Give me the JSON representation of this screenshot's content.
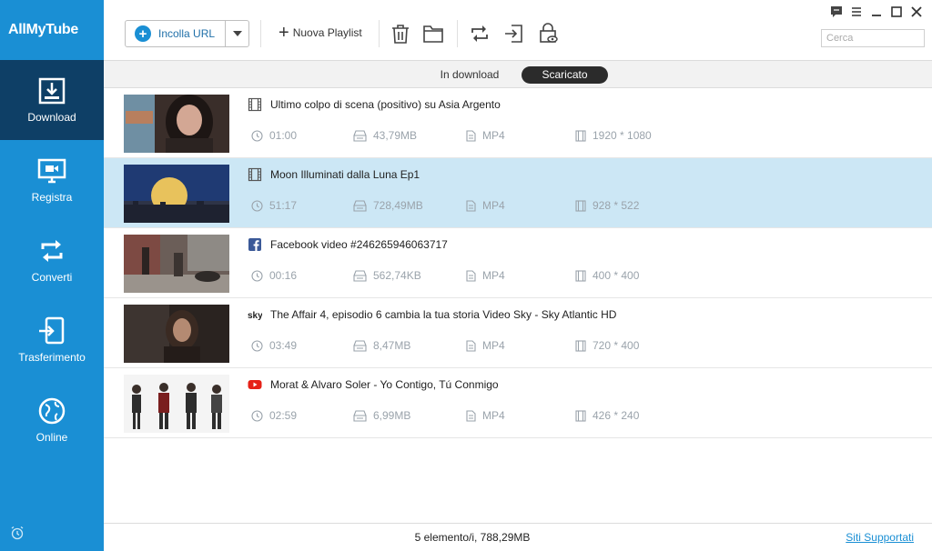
{
  "app": {
    "name": "AllMyTube"
  },
  "sidebar": {
    "items": [
      {
        "label": "Download",
        "icon": "download-icon",
        "active": true
      },
      {
        "label": "Registra",
        "icon": "record-icon"
      },
      {
        "label": "Converti",
        "icon": "convert-icon"
      },
      {
        "label": "Trasferimento",
        "icon": "transfer-icon"
      },
      {
        "label": "Online",
        "icon": "globe-icon"
      }
    ],
    "bottom_icon": "alarm-clock-icon"
  },
  "toolbar": {
    "paste_url": "Incolla URL",
    "new_playlist": "Nuova Playlist",
    "icons": [
      "trash-icon",
      "folder-icon",
      "convert-icon",
      "import-icon",
      "privacy-icon"
    ],
    "window_controls": [
      "feedback-icon",
      "menu-icon",
      "minimize-icon",
      "maximize-icon",
      "close-icon"
    ],
    "search_placeholder": "Cerca"
  },
  "tabs": {
    "downloading": "In download",
    "downloaded": "Scaricato"
  },
  "videos": [
    {
      "title": "Ultimo colpo di scena (positivo) su Asia Argento",
      "source": "film-icon",
      "duration": "01:00",
      "size": "43,79MB",
      "format": "MP4",
      "resolution": "1920 * 1080"
    },
    {
      "title": "Moon Illuminati dalla Luna Ep1",
      "source": "film-icon",
      "duration": "51:17",
      "size": "728,49MB",
      "format": "MP4",
      "resolution": "928 * 522",
      "selected": true
    },
    {
      "title": "Facebook video #246265946063717",
      "source": "facebook-icon",
      "duration": "00:16",
      "size": "562,74KB",
      "format": "MP4",
      "resolution": "400 * 400"
    },
    {
      "title": "The Affair 4, episodio 6 cambia la tua storia  Video Sky - Sky Atlantic HD",
      "source": "sky-icon",
      "duration": "03:49",
      "size": "8,47MB",
      "format": "MP4",
      "resolution": "720 * 400"
    },
    {
      "title": "Morat & Alvaro Soler - Yo Contigo, Tú Conmigo",
      "source": "youtube-icon",
      "duration": "02:59",
      "size": "6,99MB",
      "format": "MP4",
      "resolution": "426 * 240"
    }
  ],
  "footer": {
    "summary": "5 elemento/i, 788,29MB",
    "supported_sites": "Siti Supportati"
  },
  "colors": {
    "sidebar": "#1a8fd4",
    "sidebar_active": "#0e3f66",
    "selected_row": "#cce7f5",
    "link": "#1a8fd4"
  }
}
